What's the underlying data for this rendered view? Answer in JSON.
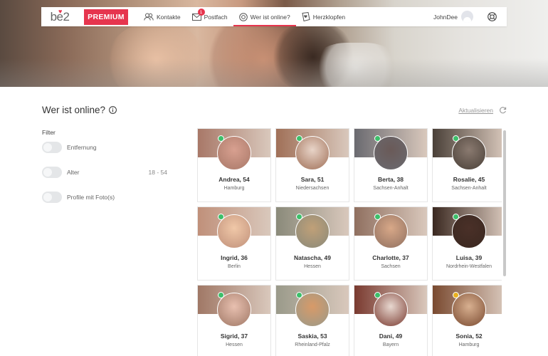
{
  "brand": {
    "logo_text": "be2",
    "premium_label": "PREMIUM",
    "accent": "#e6354e"
  },
  "nav": {
    "items": [
      {
        "id": "kontakte",
        "label": "Kontakte",
        "icon": "contacts-icon"
      },
      {
        "id": "postfach",
        "label": "Postfach",
        "icon": "mail-icon",
        "badge": "1"
      },
      {
        "id": "online",
        "label": "Wer ist online?",
        "icon": "online-icon",
        "active": true
      },
      {
        "id": "herzklopfen",
        "label": "Herzklopfen",
        "icon": "heart-card-icon"
      }
    ],
    "username": "JohnDee"
  },
  "page": {
    "title": "Wer ist online?",
    "refresh_label": "Aktualisieren"
  },
  "filter": {
    "title": "Filter",
    "rows": [
      {
        "label": "Entfernung",
        "range": ""
      },
      {
        "label": "Alter",
        "range": "18 - 54"
      },
      {
        "label": "Profile mit Foto(s)",
        "range": ""
      }
    ]
  },
  "profiles": [
    {
      "name": "Andrea, 54",
      "location": "Hamburg",
      "status": "#3dbf6a",
      "band": "#a87868",
      "photo": "#d8a090"
    },
    {
      "name": "Sara, 51",
      "location": "Niedersachsen",
      "status": "#3dbf6a",
      "band": "#a07058",
      "photo": "#e8d4c8"
    },
    {
      "name": "Berta, 38",
      "location": "Sachsen-Anhalt",
      "status": "#3dbf6a",
      "band": "#6a6a70",
      "photo": "#6a5a58"
    },
    {
      "name": "Rosalie, 45",
      "location": "Sachsen-Anhalt",
      "status": "#3dbf6a",
      "band": "#4a4038",
      "photo": "#8a7a70"
    },
    {
      "name": "Ingrid, 36",
      "location": "Berlin",
      "status": "#3dbf6a",
      "band": "#c0907a",
      "photo": "#f0c8a8"
    },
    {
      "name": "Natascha, 49",
      "location": "Hessen",
      "status": "#3dbf6a",
      "band": "#8a8a7a",
      "photo": "#c0a078"
    },
    {
      "name": "Charlotte, 37",
      "location": "Sachsen",
      "status": "#3dbf6a",
      "band": "#907060",
      "photo": "#d8a888"
    },
    {
      "name": "Luisa, 39",
      "location": "Nordrhein-Westfalen",
      "status": "#3dbf6a",
      "band": "#3a2820",
      "photo": "#4a3028"
    },
    {
      "name": "Sigrid, 37",
      "location": "Hessen",
      "status": "#3dbf6a",
      "band": "#a07866",
      "photo": "#e8c0b0"
    },
    {
      "name": "Saskia, 53",
      "location": "Rheinland-Pfalz",
      "status": "#3dbf6a",
      "band": "#9a9a8a",
      "photo": "#d89a68"
    },
    {
      "name": "Dani, 49",
      "location": "Bayern",
      "status": "#3dbf6a",
      "band": "#7a3a30",
      "photo": "#e8d8d0"
    },
    {
      "name": "Sonia, 52",
      "location": "Hamburg",
      "status": "#e8b020",
      "band": "#7a4a30",
      "photo": "#d8b090"
    }
  ]
}
